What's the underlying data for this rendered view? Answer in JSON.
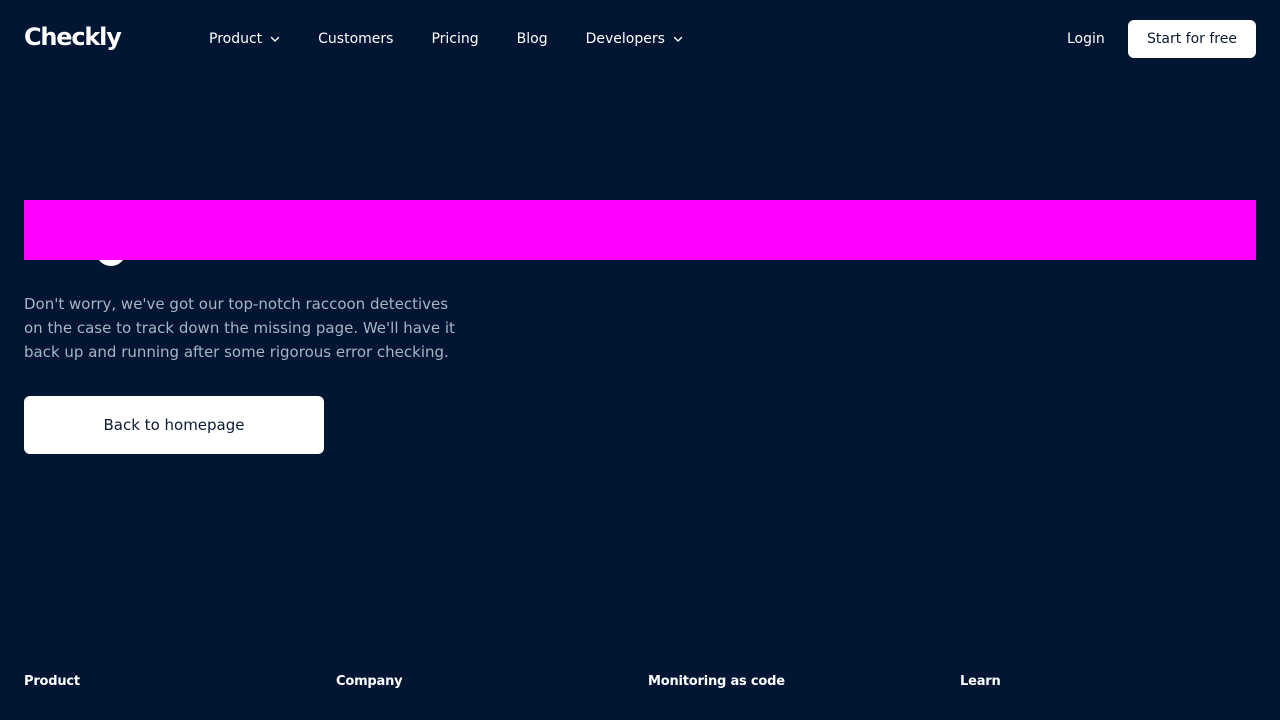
{
  "brand": {
    "logo_text": "Checkly",
    "accent_color": "#2563eb"
  },
  "nav": {
    "items": [
      {
        "label": "Product",
        "has_dropdown": true
      },
      {
        "label": "Customers",
        "has_dropdown": false
      },
      {
        "label": "Pricing",
        "has_dropdown": false
      },
      {
        "label": "Blog",
        "has_dropdown": false
      },
      {
        "label": "Developers",
        "has_dropdown": true
      }
    ],
    "login_label": "Login",
    "cta_label": "Start for free"
  },
  "hero": {
    "description": "Don't worry, we've got our top-notch raccoon detectives on the case to track down the missing page. We'll have it back up and running after some rigorous error checking.",
    "back_button_label": "Back to homepage",
    "redacted_color": "#ff00ff"
  },
  "footer": {
    "columns": [
      {
        "heading": "Product"
      },
      {
        "heading": "Company"
      },
      {
        "heading": "Monitoring as code"
      },
      {
        "heading": "Learn"
      }
    ]
  },
  "colors": {
    "background": "#021532",
    "text_primary": "#ffffff",
    "text_muted": "#a9b3c4"
  }
}
